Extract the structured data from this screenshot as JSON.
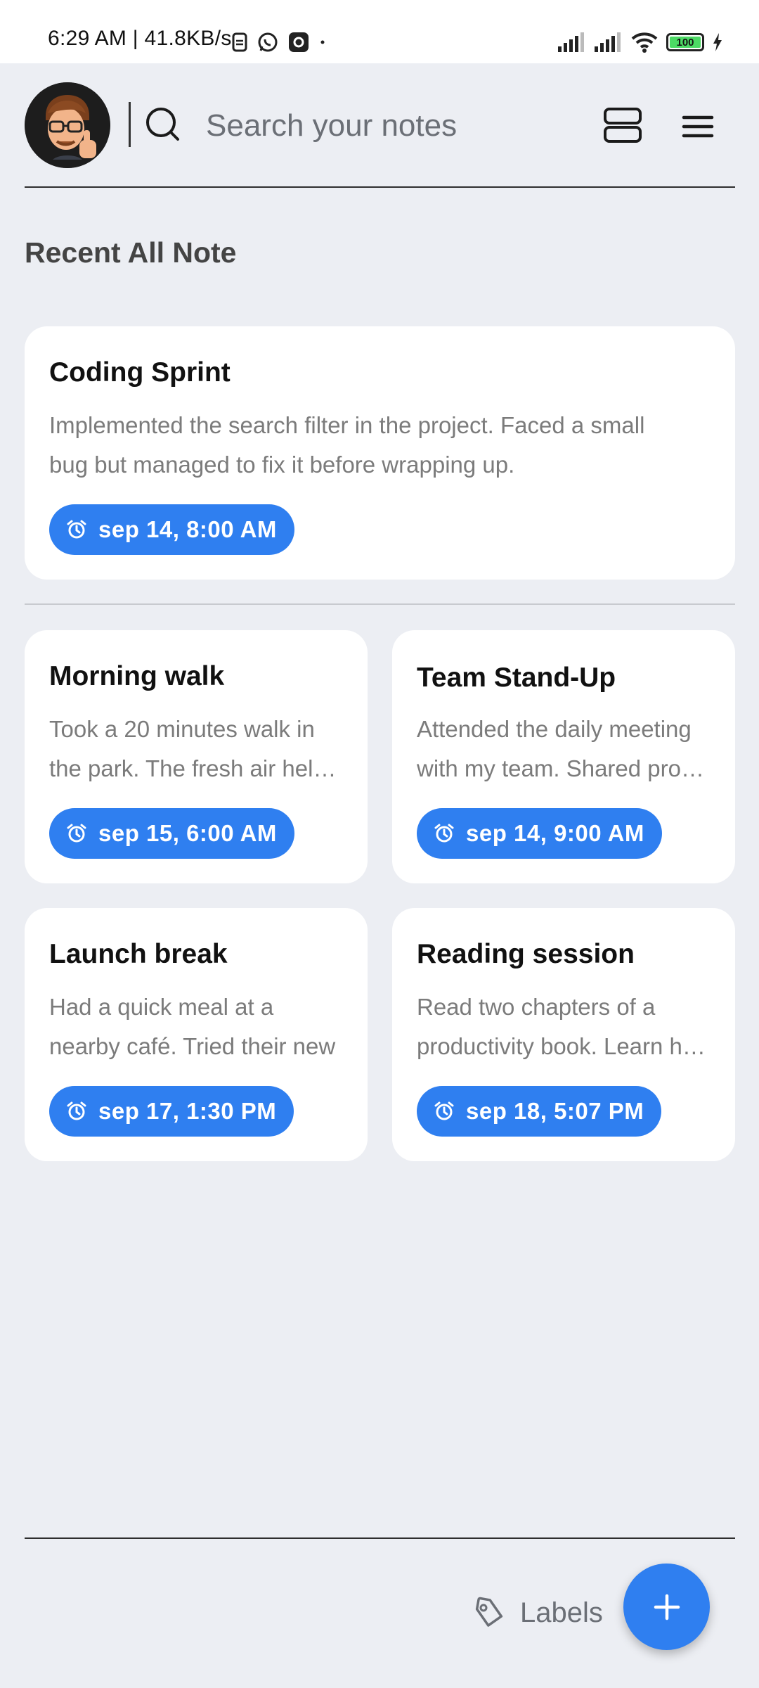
{
  "status_bar": {
    "time": "6:29 AM | 41.8KB/s",
    "battery": "100"
  },
  "header": {
    "search_placeholder": "Search your notes",
    "icons": [
      "search-icon",
      "layout-toggle-icon",
      "menu-icon"
    ]
  },
  "section_title": "Recent All Note",
  "featured_note": {
    "title": "Coding Sprint",
    "body": "Implemented the search filter in the project. Faced a small bug but managed to fix it before wrapping up.",
    "reminder": "sep 14, 8:00 AM"
  },
  "notes": [
    {
      "title": "Morning walk",
      "line1": "Took a 20 minutes walk in",
      "line2": "the park. The fresh air helped",
      "reminder": "sep 15, 6:00 AM"
    },
    {
      "title": "Team Stand-Up",
      "line1": "Attended the daily meeting",
      "line2": "with my team. Shared progress",
      "reminder": "sep 14, 9:00 AM"
    },
    {
      "title": "Launch break",
      "line1": "Had a quick meal at a",
      "line2": "nearby café. Tried their new",
      "reminder": "sep 17, 1:30 PM"
    },
    {
      "title": "Reading session",
      "line1": "Read two chapters of a",
      "line2": "productivity book. Learn how",
      "reminder": "sep 18, 5:07 PM"
    }
  ],
  "bottom_bar": {
    "labels_label": "Labels"
  },
  "colors": {
    "accent": "#2f7ff0",
    "background": "#eceef3",
    "card": "#ffffff"
  }
}
